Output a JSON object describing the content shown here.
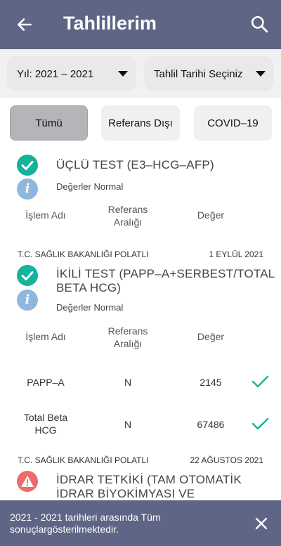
{
  "header": {
    "title": "Tahlillerim",
    "back_icon": "arrow-left-icon",
    "search_icon": "search-icon"
  },
  "filters": {
    "year_label": "Yıl: 2021 – 2021",
    "date_label": "Tahlil Tarihi Seçiniz"
  },
  "chips": {
    "all": "Tümü",
    "out_of_range": "Referans Dışı",
    "covid": "COVID–19"
  },
  "columns": {
    "name": "İşlem Adı",
    "range_line1": "Referans",
    "range_line2": "Aralığı",
    "value": "Değer"
  },
  "tests": [
    {
      "title": "ÜÇLÜ TEST (E3–HCG–AFP)",
      "status_text": "Değerler Normal"
    },
    {
      "source": "T.C. SAĞLIK BAKANLIĞI POLATLI",
      "date": "1 EYLÜL 2021",
      "title_line1": "İKİLİ TEST (PAPP–A+SERBEST/TOTAL",
      "title_line2": "BETA HCG)",
      "status_text": "Değerler Normal",
      "rows": [
        {
          "name_line1": "PAPP–A",
          "name_line2": "",
          "range": "N",
          "value": "2145"
        },
        {
          "name_line1": "Total Beta",
          "name_line2": "HCG",
          "range": "N",
          "value": "67486"
        }
      ]
    },
    {
      "source": "T.C. SAĞLIK BAKANLIĞI POLATLI",
      "date": "22 AĞUSTOS 2021",
      "title_line1": "İDRAR TETKİKİ (TAM OTOMATİK",
      "title_line2": "İDRAR BİYOKİMYASI VE"
    }
  ],
  "snackbar": {
    "message": "2021 - 2021 tarihleri arasında Tüm sonuçlargösterilmektedir."
  },
  "colors": {
    "primary": "#5e6585",
    "ok": "#14b39a",
    "info": "#8fb7de",
    "warn": "#ef6a6a"
  }
}
